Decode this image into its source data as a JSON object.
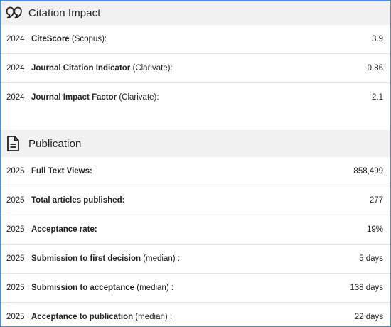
{
  "citation": {
    "title": "Citation Impact",
    "icon": "quote-bubbles-icon",
    "rows": [
      {
        "year": "2024",
        "label_bold": "CiteScore",
        "label_rest": " (Scopus):",
        "value": "3.9"
      },
      {
        "year": "2024",
        "label_bold": "Journal Citation Indicator",
        "label_rest": " (Clarivate):",
        "value": "0.86"
      },
      {
        "year": "2024",
        "label_bold": "Journal Impact Factor",
        "label_rest": " (Clarivate):",
        "value": "2.1"
      }
    ]
  },
  "publication": {
    "title": "Publication",
    "icon": "document-icon",
    "rows": [
      {
        "year": "2025",
        "label_bold": "Full Text Views:",
        "label_rest": "",
        "value": "858,499"
      },
      {
        "year": "2025",
        "label_bold": "Total articles published:",
        "label_rest": "",
        "value": "277"
      },
      {
        "year": "2025",
        "label_bold": "Acceptance rate:",
        "label_rest": "",
        "value": "19%"
      },
      {
        "year": "2025",
        "label_bold": "Submission to first decision",
        "label_rest": " (median) :",
        "value": "5 days"
      },
      {
        "year": "2025",
        "label_bold": "Submission to acceptance",
        "label_rest": " (median) :",
        "value": "138 days"
      },
      {
        "year": "2025",
        "label_bold": "Acceptance to publication",
        "label_rest": " (median) :",
        "value": "22 days"
      }
    ]
  }
}
